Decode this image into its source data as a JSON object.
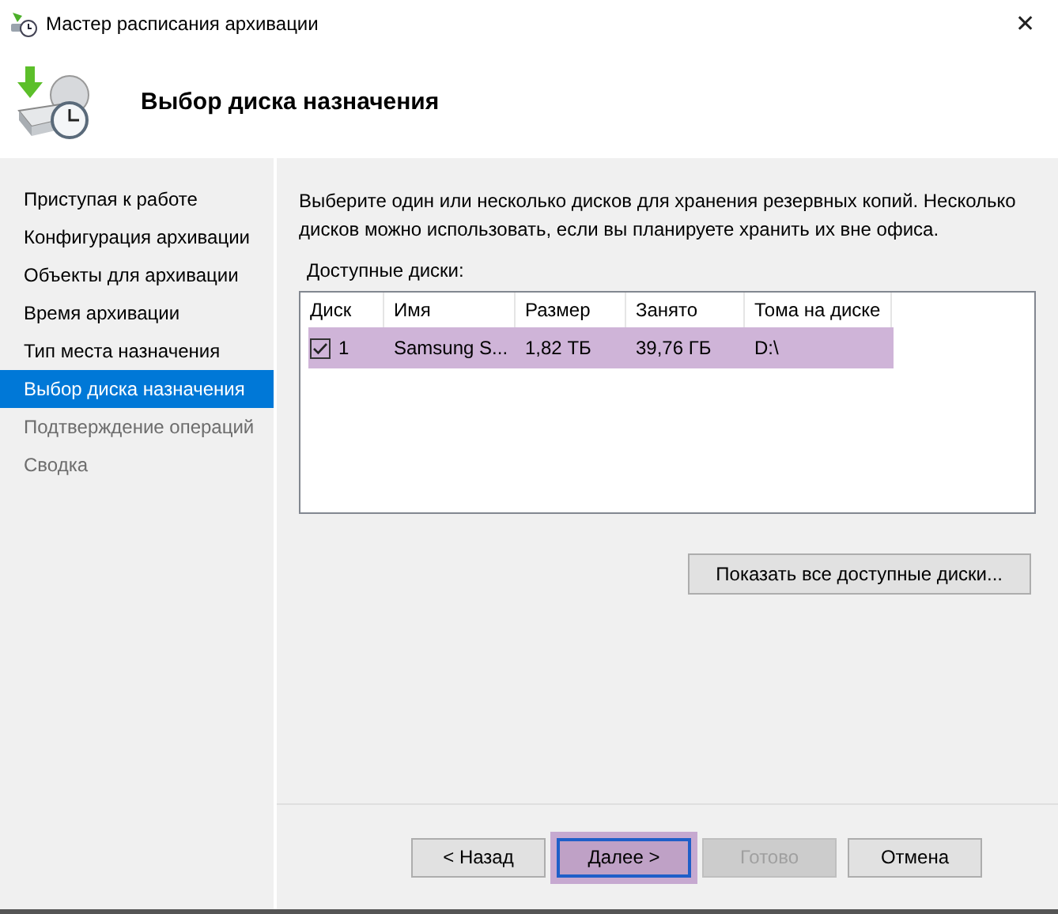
{
  "window": {
    "title": "Мастер расписания архивации",
    "close": "✕"
  },
  "header": {
    "title": "Выбор диска назначения"
  },
  "sidebar": {
    "items": [
      {
        "label": "Приступая к работе",
        "selected": false,
        "disabled": false
      },
      {
        "label": "Конфигурация архивации",
        "selected": false,
        "disabled": false
      },
      {
        "label": "Объекты для архивации",
        "selected": false,
        "disabled": false
      },
      {
        "label": "Время архивации",
        "selected": false,
        "disabled": false
      },
      {
        "label": "Тип места назначения",
        "selected": false,
        "disabled": false
      },
      {
        "label": "Выбор диска назначения",
        "selected": true,
        "disabled": false
      },
      {
        "label": "Подтверждение операций",
        "selected": false,
        "disabled": true
      },
      {
        "label": "Сводка",
        "selected": false,
        "disabled": true
      }
    ]
  },
  "description": "Выберите один или несколько дисков для хранения резервных копий. Несколько дисков можно использовать, если вы планируете хранить их вне офиса.",
  "disks": {
    "label": "Доступные диски:",
    "columns": [
      "Диск",
      "Имя",
      "Размер",
      "Занято",
      "Тома на диске"
    ],
    "rows": [
      {
        "checked": true,
        "highlighted": true,
        "cells": [
          "1",
          "Samsung S...",
          "1,82 ТБ",
          "39,76 ГБ",
          "D:\\"
        ]
      }
    ]
  },
  "show_all_button": "Показать все доступные диски...",
  "buttons": [
    {
      "label": "< Назад",
      "disabled": false,
      "highlighted": false
    },
    {
      "label": "Далее >",
      "disabled": false,
      "highlighted": true
    },
    {
      "label": "Готово",
      "disabled": true,
      "highlighted": false
    },
    {
      "label": "Отмена",
      "disabled": false,
      "highlighted": false
    }
  ]
}
